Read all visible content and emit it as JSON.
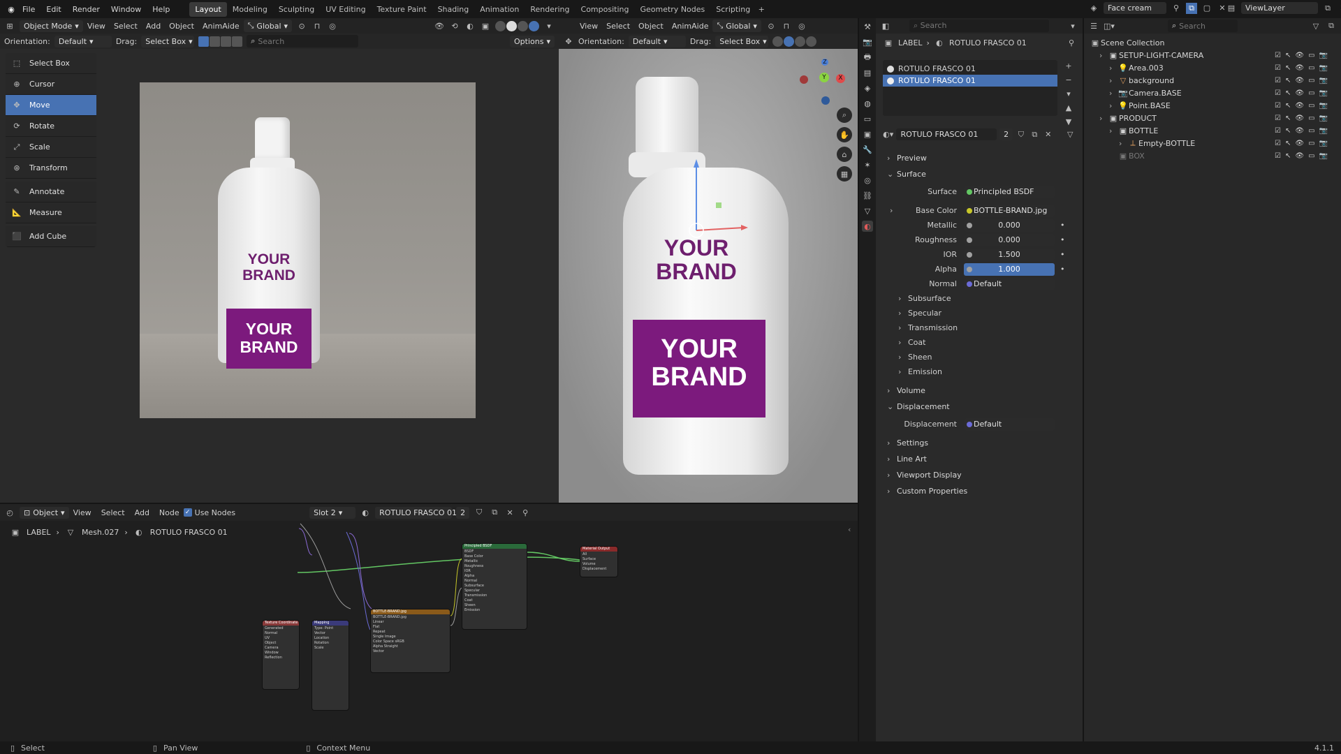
{
  "menu": [
    "File",
    "Edit",
    "Render",
    "Window",
    "Help"
  ],
  "workspaces": [
    "Layout",
    "Modeling",
    "Sculpting",
    "UV Editing",
    "Texture Paint",
    "Shading",
    "Animation",
    "Rendering",
    "Compositing",
    "Geometry Nodes",
    "Scripting"
  ],
  "active_workspace": "Layout",
  "scene_name": "Face cream",
  "view_layer": "ViewLayer",
  "left_view": {
    "mode": "Object Mode",
    "menu": [
      "View",
      "Select",
      "Add",
      "Object",
      "AnimAide"
    ],
    "transform": "Global",
    "orientation_label": "Orientation:",
    "orientation": "Default",
    "drag_label": "Drag:",
    "drag": "Select Box",
    "search_placeholder": "Search",
    "options": "Options",
    "tools": [
      "Select Box",
      "Cursor",
      "Move",
      "Rotate",
      "Scale",
      "Transform",
      "Annotate",
      "Measure",
      "Add Cube"
    ],
    "active_tool": "Move"
  },
  "right_view": {
    "menu": [
      "View",
      "Select",
      "Object",
      "AnimAide"
    ],
    "transform": "Global",
    "orientation_label": "Orientation:",
    "orientation": "Default",
    "drag_label": "Drag:",
    "drag": "Select Box",
    "gizmo": {
      "x": "X",
      "y": "Y",
      "z": "Z"
    }
  },
  "render_text": {
    "brand1": "YOUR",
    "brand2": "BRAND"
  },
  "properties": {
    "breadcrumb": [
      "LABEL",
      "ROTULO FRASCO 01"
    ],
    "slots": [
      "ROTULO FRASCO 01",
      "ROTULO FRASCO 01"
    ],
    "material_name": "ROTULO FRASCO 01",
    "users": "2",
    "preview": "Preview",
    "surface_section": "Surface",
    "surface_label": "Surface",
    "surface_value": "Principled BSDF",
    "fields": [
      {
        "label": "Base Color",
        "value": "BOTTLE-BRAND.jpg",
        "type": "tex"
      },
      {
        "label": "Metallic",
        "value": "0.000",
        "type": "num"
      },
      {
        "label": "Roughness",
        "value": "0.000",
        "type": "num"
      },
      {
        "label": "IOR",
        "value": "1.500",
        "type": "num"
      },
      {
        "label": "Alpha",
        "value": "1.000",
        "type": "blue"
      },
      {
        "label": "Normal",
        "value": "Default",
        "type": "vec"
      }
    ],
    "subsections": [
      "Subsurface",
      "Specular",
      "Transmission",
      "Coat",
      "Sheen",
      "Emission"
    ],
    "volume": "Volume",
    "displacement_section": "Displacement",
    "displacement_label": "Displacement",
    "displacement_value": "Default",
    "bottom_sections": [
      "Settings",
      "Line Art",
      "Viewport Display",
      "Custom Properties"
    ]
  },
  "outliner": {
    "search_placeholder": "Search",
    "root": "Scene Collection",
    "items": [
      {
        "name": "SETUP-LIGHT-CAMERA",
        "indent": 1,
        "icon": "collection"
      },
      {
        "name": "Area.003",
        "indent": 2,
        "icon": "light"
      },
      {
        "name": "background",
        "indent": 2,
        "icon": "mesh"
      },
      {
        "name": "Camera.BASE",
        "indent": 2,
        "icon": "camera"
      },
      {
        "name": "Point.BASE",
        "indent": 2,
        "icon": "light"
      },
      {
        "name": "PRODUCT",
        "indent": 1,
        "icon": "collection"
      },
      {
        "name": "BOTTLE",
        "indent": 2,
        "icon": "collection"
      },
      {
        "name": "Empty-BOTTLE",
        "indent": 3,
        "icon": "empty"
      },
      {
        "name": "BOX",
        "indent": 2,
        "icon": "collection-off"
      }
    ]
  },
  "node_editor": {
    "type": "Object",
    "menu": [
      "View",
      "Select",
      "Add",
      "Node"
    ],
    "use_nodes": "Use Nodes",
    "slot": "Slot 2",
    "material": "ROTULO FRASCO 01",
    "users": "2",
    "breadcrumb": [
      "LABEL",
      "Mesh.027",
      "ROTULO FRASCO 01"
    ],
    "nodes": {
      "texcoord": {
        "title": "Texture Coordinate",
        "outs": [
          "Generated",
          "Normal",
          "UV",
          "Object",
          "Camera",
          "Window",
          "Reflection"
        ]
      },
      "mapping": {
        "title": "Mapping",
        "rows": [
          "Type: Point",
          "Vector",
          "Location",
          "Rotation",
          "Scale"
        ]
      },
      "image": {
        "title": "BOTTLE-BRAND.jpg",
        "rows": [
          "BOTTLE-BRAND.jpg",
          "Linear",
          "Flat",
          "Repeat",
          "Single Image",
          "Color Space  sRGB",
          "Alpha  Straight",
          "Vector"
        ]
      },
      "bsdf": {
        "title": "Principled BSDF",
        "rows": [
          "BSDF",
          "Base Color",
          "Metallic",
          "Roughness",
          "IOR",
          "Alpha",
          "Normal",
          "Subsurface",
          "Specular",
          "Transmission",
          "Coat",
          "Sheen",
          "Emission"
        ]
      },
      "output": {
        "title": "Material Output",
        "rows": [
          "All",
          "Surface",
          "Volume",
          "Displacement"
        ]
      }
    }
  },
  "status": {
    "select": "Select",
    "pan": "Pan View",
    "context": "Context Menu",
    "version": "4.1.1"
  }
}
